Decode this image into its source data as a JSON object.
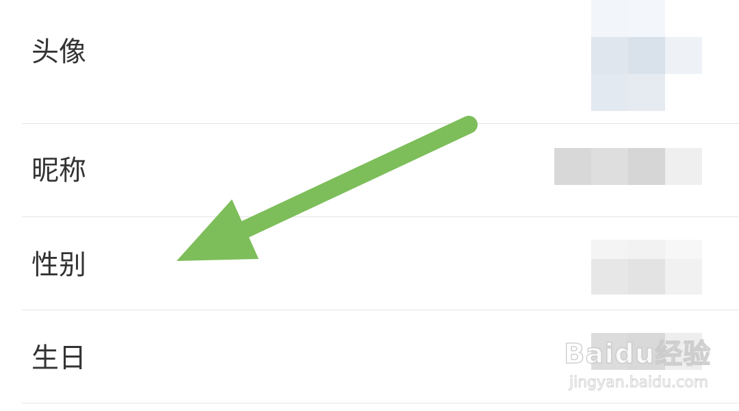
{
  "profile": {
    "rows": [
      {
        "label": "头像",
        "value": ""
      },
      {
        "label": "昵称",
        "value": ""
      },
      {
        "label": "性别",
        "value": ""
      },
      {
        "label": "生日",
        "value": ""
      }
    ]
  },
  "annotation": {
    "arrow_color": "#7dbe5a",
    "arrow_icon": "green-arrow-pointing-down-left"
  },
  "watermark": {
    "brand": "Baidu经验",
    "url": "jingyan.baidu.com"
  }
}
